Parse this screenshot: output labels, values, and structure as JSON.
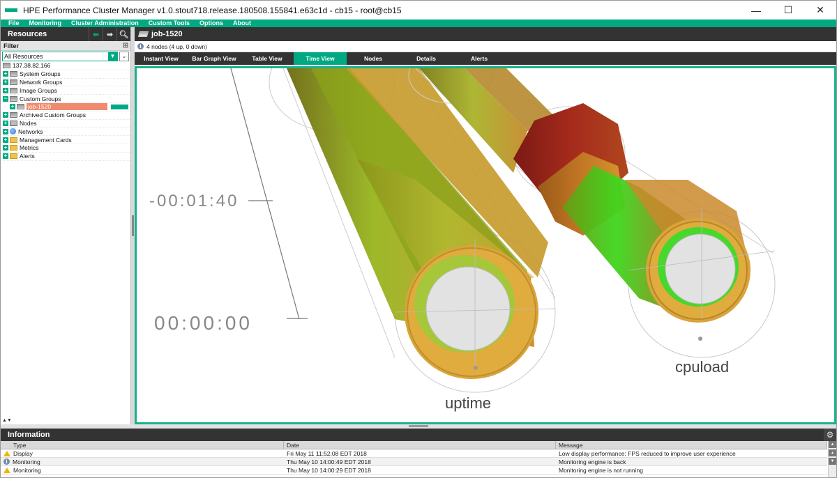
{
  "window": {
    "title": "HPE Performance Cluster Manager v1.0.stout718.release.180508.155841.e63c1d - cb15 - root@cb15",
    "minimize": "—",
    "maximize": "☐",
    "close": "✕"
  },
  "menu": [
    "File",
    "Monitoring",
    "Cluster Administration",
    "Custom Tools",
    "Options",
    "About"
  ],
  "resources": {
    "title": "Resources",
    "filter_label": "Filter",
    "select_value": "All Resources",
    "tree": [
      {
        "label": "137.38.82.166"
      },
      {
        "label": "System Groups"
      },
      {
        "label": "Network Groups"
      },
      {
        "label": "Image Groups"
      },
      {
        "label": "Custom Groups"
      },
      {
        "label": "job-1520"
      },
      {
        "label": "Archived Custom Groups"
      },
      {
        "label": "Nodes"
      },
      {
        "label": "Networks"
      },
      {
        "label": "Management Cards"
      },
      {
        "label": "Metrics"
      },
      {
        "label": "Alerts"
      }
    ]
  },
  "job": {
    "title": "job-1520",
    "status": "4 nodes (4 up, 0 down)"
  },
  "tabs": [
    "Instant View",
    "Bar Graph View",
    "Table View",
    "Time View",
    "Nodes",
    "Details",
    "Alerts"
  ],
  "active_tab": "Time View",
  "time_view": {
    "time_label_top": "-00:01:40",
    "time_label_bottom": "00:00:00",
    "metric_left": "uptime",
    "metric_right": "cpuload"
  },
  "information": {
    "title": "Information",
    "columns": [
      "Type",
      "Date",
      "Message"
    ],
    "rows": [
      {
        "type": "Display",
        "date": "Fri May 11 11:52:08 EDT 2018",
        "message": "Low display performance: FPS reduced to improve user experience"
      },
      {
        "type": "Monitoring",
        "date": "Thu May 10 14:00:49 EDT 2018",
        "message": "Monitoring engine is back"
      },
      {
        "type": "Monitoring",
        "date": "Thu May 10 14:00:29 EDT 2018",
        "message": "Monitoring engine is not running"
      }
    ]
  },
  "colors": {
    "accent": "#01a982",
    "selected": "#f08a6e",
    "dark_header": "#333333"
  }
}
